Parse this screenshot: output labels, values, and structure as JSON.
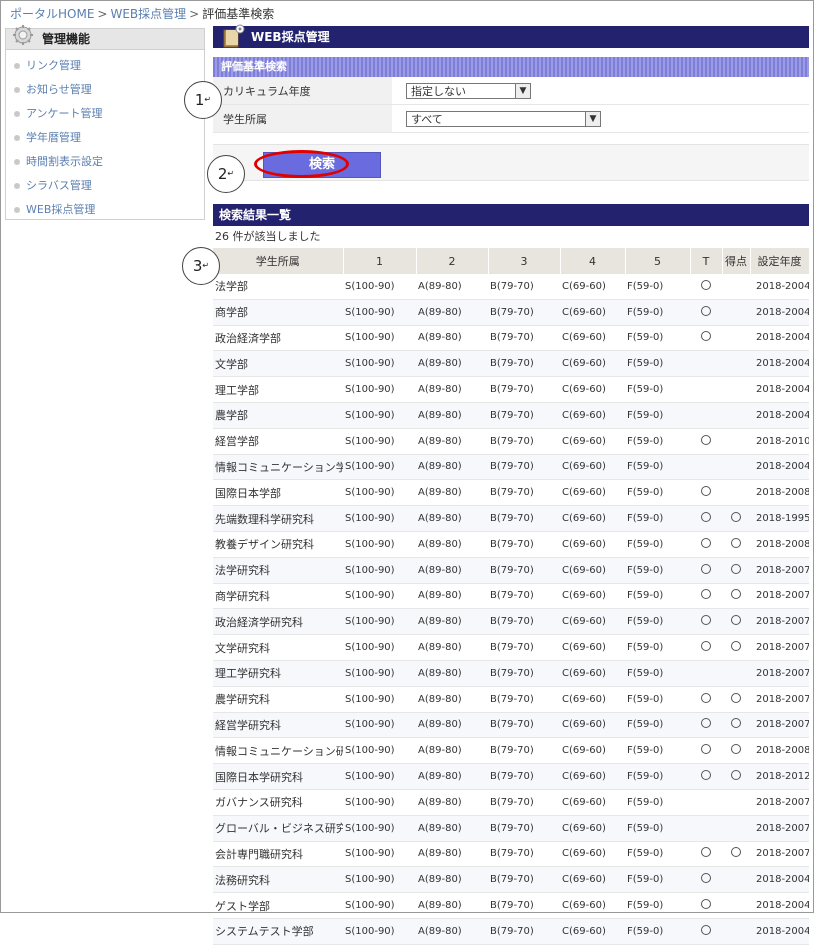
{
  "breadcrumb": {
    "home": "ポータルHOME",
    "section": "WEB採点管理",
    "current": "評価基準検索",
    "separator": ">"
  },
  "sidebar": {
    "title": "管理機能",
    "items": [
      "リンク管理",
      "お知らせ管理",
      "アンケート管理",
      "学年暦管理",
      "時間割表示設定",
      "シラバス管理",
      "WEB採点管理"
    ]
  },
  "header": {
    "title": "WEB採点管理"
  },
  "search_panel": {
    "title": "評価基準検索",
    "curriculum_label": "カリキュラム年度",
    "curriculum_value": "指定しない",
    "affiliation_label": "学生所属",
    "affiliation_value": "すべて",
    "search_button": "検索"
  },
  "callouts": {
    "one": "1",
    "two": "2",
    "three": "3",
    "return_mark": "↵"
  },
  "results": {
    "title": "検索結果一覧",
    "count_text": "26 件が該当しました",
    "columns": [
      "学生所属",
      "1",
      "2",
      "3",
      "4",
      "5",
      "T",
      "得点",
      "設定年度"
    ],
    "grades": [
      "S(100-90)",
      "A(89-80)",
      "B(79-70)",
      "C(69-60)",
      "F(59-0)"
    ],
    "rows": [
      {
        "name": "法学部",
        "t": true,
        "score": false,
        "year": "2018-2004"
      },
      {
        "name": "商学部",
        "t": true,
        "score": false,
        "year": "2018-2004"
      },
      {
        "name": "政治経済学部",
        "t": true,
        "score": false,
        "year": "2018-2004"
      },
      {
        "name": "文学部",
        "t": false,
        "score": false,
        "year": "2018-2004"
      },
      {
        "name": "理工学部",
        "t": false,
        "score": false,
        "year": "2018-2004"
      },
      {
        "name": "農学部",
        "t": false,
        "score": false,
        "year": "2018-2004"
      },
      {
        "name": "経営学部",
        "t": true,
        "score": false,
        "year": "2018-2010"
      },
      {
        "name": "情報コミュニケーション学部",
        "t": false,
        "score": false,
        "year": "2018-2004"
      },
      {
        "name": "国際日本学部",
        "t": true,
        "score": false,
        "year": "2018-2008"
      },
      {
        "name": "先端数理科学研究科",
        "t": true,
        "score": true,
        "year": "2018-1995"
      },
      {
        "name": "教養デザイン研究科",
        "t": true,
        "score": true,
        "year": "2018-2008"
      },
      {
        "name": "法学研究科",
        "t": true,
        "score": true,
        "year": "2018-2007"
      },
      {
        "name": "商学研究科",
        "t": true,
        "score": true,
        "year": "2018-2007"
      },
      {
        "name": "政治経済学研究科",
        "t": true,
        "score": true,
        "year": "2018-2007"
      },
      {
        "name": "文学研究科",
        "t": true,
        "score": true,
        "year": "2018-2007"
      },
      {
        "name": "理工学研究科",
        "t": false,
        "score": false,
        "year": "2018-2007"
      },
      {
        "name": "農学研究科",
        "t": true,
        "score": true,
        "year": "2018-2007"
      },
      {
        "name": "経営学研究科",
        "t": true,
        "score": true,
        "year": "2018-2007"
      },
      {
        "name": "情報コミュニケーション研究科",
        "t": true,
        "score": true,
        "year": "2018-2008"
      },
      {
        "name": "国際日本学研究科",
        "t": true,
        "score": true,
        "year": "2018-2012"
      },
      {
        "name": "ガバナンス研究科",
        "t": false,
        "score": false,
        "year": "2018-2007"
      },
      {
        "name": "グローバル・ビジネス研究科",
        "t": false,
        "score": false,
        "year": "2018-2007"
      },
      {
        "name": "会計専門職研究科",
        "t": true,
        "score": true,
        "year": "2018-2007"
      },
      {
        "name": "法務研究科",
        "t": true,
        "score": false,
        "year": "2018-2004"
      },
      {
        "name": "ゲスト学部",
        "t": true,
        "score": false,
        "year": "2018-2004"
      },
      {
        "name": "システムテスト学部",
        "t": true,
        "score": false,
        "year": "2018-2004"
      }
    ]
  }
}
